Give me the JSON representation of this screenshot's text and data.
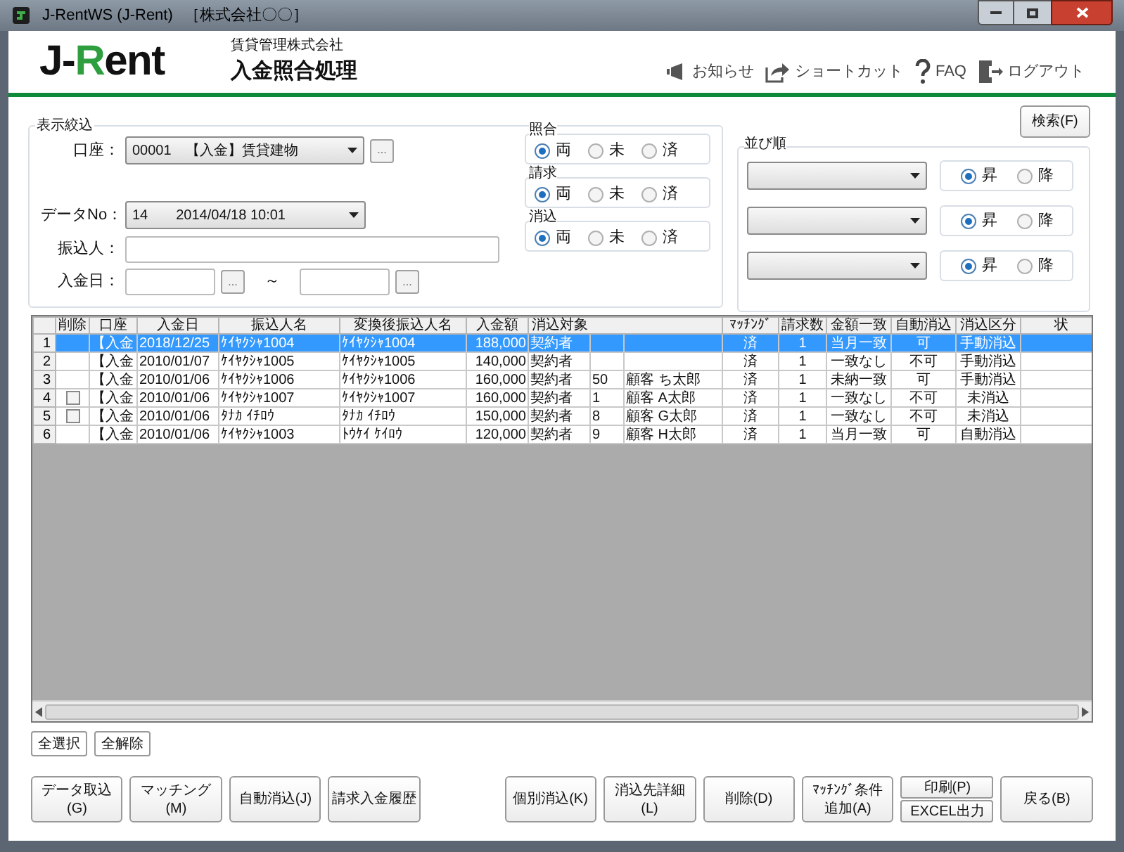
{
  "window": {
    "title": "J-RentWS (J-Rent)",
    "company": "［株式会社〇〇］"
  },
  "header": {
    "logo": [
      {
        "text": "J-",
        "color": "#111111"
      },
      {
        "text": "R",
        "color": "#2e9e3e"
      },
      {
        "text": "ent",
        "color": "#111111"
      }
    ],
    "company": "賃貸管理株式会社",
    "title": "入金照合処理",
    "links": [
      {
        "kind": "notice",
        "label": "お知らせ"
      },
      {
        "kind": "shortcut",
        "label": "ショートカット"
      },
      {
        "kind": "faq",
        "label": "FAQ"
      },
      {
        "kind": "logout",
        "label": "ログアウト"
      }
    ]
  },
  "filter": {
    "title": "表示絞込",
    "account_label": "口座：",
    "account_value": "00001　【入金】賃貸建物",
    "ellipsis": "...",
    "data_no_label": "データNo：",
    "data_no_value": "14　　2014/04/18 10:01",
    "payer_label": "振込人：",
    "date_label": "入金日：",
    "tilde": "～",
    "radio_groups": [
      {
        "title": "照合",
        "options": [
          {
            "label": "両",
            "selected": true
          },
          {
            "label": "未",
            "selected": false
          },
          {
            "label": "済",
            "selected": false
          }
        ]
      },
      {
        "title": "請求",
        "options": [
          {
            "label": "両",
            "selected": true
          },
          {
            "label": "未",
            "selected": false
          },
          {
            "label": "済",
            "selected": false
          }
        ]
      },
      {
        "title": "消込",
        "options": [
          {
            "label": "両",
            "selected": true
          },
          {
            "label": "未",
            "selected": false
          },
          {
            "label": "済",
            "selected": false
          }
        ]
      }
    ]
  },
  "search_button": "検索(F)",
  "sort": {
    "title": "並び順",
    "rows": [
      {
        "options": [
          {
            "label": "昇",
            "selected": true
          },
          {
            "label": "降",
            "selected": false
          }
        ]
      },
      {
        "options": [
          {
            "label": "昇",
            "selected": true
          },
          {
            "label": "降",
            "selected": false
          }
        ]
      },
      {
        "options": [
          {
            "label": "昇",
            "selected": true
          },
          {
            "label": "降",
            "selected": false
          }
        ]
      }
    ]
  },
  "table": {
    "columns": [
      "削除",
      "口座",
      "入金日",
      "振込人名",
      "変換後振込人名",
      "入金額",
      "消込対象",
      null,
      null,
      "ﾏｯﾁﾝｸﾞ",
      "請求数",
      "金額一致",
      "自動消込",
      "消込区分",
      "状"
    ],
    "rows": [
      {
        "number": "1",
        "selected": true,
        "cells": [
          null,
          "【入金",
          "2018/12/25",
          "ｹｲﾔｸｼｬ1004",
          "ｹｲﾔｸｼｬ1004",
          "188,000",
          "契約者",
          null,
          null,
          "済",
          "1",
          "当月一致",
          "可",
          "手動消込"
        ]
      },
      {
        "number": "2",
        "selected": false,
        "cells": [
          null,
          "【入金",
          "2010/01/07",
          "ｹｲﾔｸｼｬ1005",
          "ｹｲﾔｸｼｬ1005",
          "140,000",
          "契約者",
          null,
          null,
          "済",
          "1",
          "一致なし",
          "不可",
          "手動消込"
        ]
      },
      {
        "number": "3",
        "selected": false,
        "cells": [
          null,
          "【入金",
          "2010/01/06",
          "ｹｲﾔｸｼｬ1006",
          "ｹｲﾔｸｼｬ1006",
          "160,000",
          "契約者",
          "50",
          "顧客 ち太郎",
          "済",
          "1",
          "未納一致",
          "可",
          "手動消込"
        ]
      },
      {
        "number": "4",
        "selected": false,
        "cells": [
          {
            "kind": "checkbox",
            "checked": false
          },
          "【入金",
          "2010/01/06",
          "ｹｲﾔｸｼｬ1007",
          "ｹｲﾔｸｼｬ1007",
          "160,000",
          "契約者",
          "1",
          "顧客 A太郎",
          "済",
          "1",
          "一致なし",
          "不可",
          "未消込"
        ]
      },
      {
        "number": "5",
        "selected": false,
        "cells": [
          {
            "kind": "checkbox",
            "checked": false
          },
          "【入金",
          "2010/01/06",
          "ﾀﾅｶ ｲﾁﾛｳ",
          "ﾀﾅｶ ｲﾁﾛｳ",
          "150,000",
          "契約者",
          "8",
          "顧客 G太郎",
          "済",
          "1",
          "一致なし",
          "不可",
          "未消込"
        ]
      },
      {
        "number": "6",
        "selected": false,
        "cells": [
          null,
          "【入金",
          "2010/01/06",
          "ｹｲﾔｸｼｬ1003",
          "ﾄｳｹｲ ｹｲﾛｳ",
          "120,000",
          "契約者",
          "9",
          "顧客 H太郎",
          "済",
          "1",
          "当月一致",
          "可",
          "自動消込"
        ]
      }
    ]
  },
  "selection_buttons": [
    "全選択",
    "全解除"
  ],
  "actions": [
    {
      "kind": "single",
      "lines": [
        "データ取込",
        "(G)"
      ]
    },
    {
      "kind": "single",
      "lines": [
        "マッチング",
        "(M)"
      ]
    },
    {
      "kind": "single",
      "lines": [
        "自動消込(J)"
      ]
    },
    {
      "kind": "single",
      "lines": [
        "請求入金履歴"
      ]
    },
    {
      "kind": "gap"
    },
    {
      "kind": "single",
      "lines": [
        "個別消込(K)"
      ]
    },
    {
      "kind": "single",
      "lines": [
        "消込先詳細",
        "(L)"
      ]
    },
    {
      "kind": "single",
      "lines": [
        "削除(D)"
      ]
    },
    {
      "kind": "single",
      "lines": [
        "ﾏｯﾁﾝｸﾞ条件",
        "追加(A)"
      ]
    },
    {
      "kind": "stack",
      "lines": [
        "印刷(P)",
        "EXCEL出力"
      ]
    },
    {
      "kind": "single",
      "lines": [
        "戻る(B)"
      ]
    }
  ]
}
